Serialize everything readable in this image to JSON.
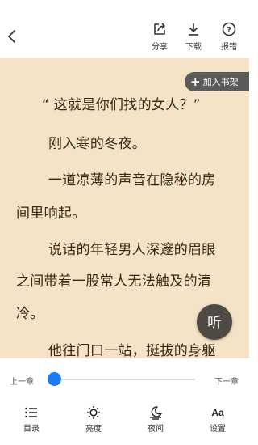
{
  "topbar": {
    "actions": [
      {
        "label": "分享",
        "icon": "share-icon"
      },
      {
        "label": "下载",
        "icon": "download-icon"
      },
      {
        "label": "报错",
        "icon": "help-circle-icon"
      }
    ],
    "back_icon": "chevron-left-icon"
  },
  "reader": {
    "background": "#f4e3c6",
    "text_color": "#3c2712",
    "add_to_shelf": "加入书架",
    "lines": [
      "“ 这就是你们找的女人？”",
      "刚入寒的冬夜。",
      "一道凉薄的声音在隐秘的房",
      "间里响起。",
      "说话的年轻男人深邃的眉眼",
      "之间带着一股常人无法触及的清",
      "冷。",
      "他往门口一站，挺拔的身躯"
    ],
    "listen_label": "听"
  },
  "bottom": {
    "prev_chapter": "上一章",
    "next_chapter": "下一章",
    "progress": 0.0,
    "accent": "#1d7cf2",
    "tools": [
      {
        "label": "目录",
        "icon": "list-icon"
      },
      {
        "label": "亮度",
        "icon": "brightness-icon"
      },
      {
        "label": "夜间",
        "icon": "night-mode-icon"
      },
      {
        "label": "设置",
        "icon": "font-settings-icon"
      }
    ]
  }
}
